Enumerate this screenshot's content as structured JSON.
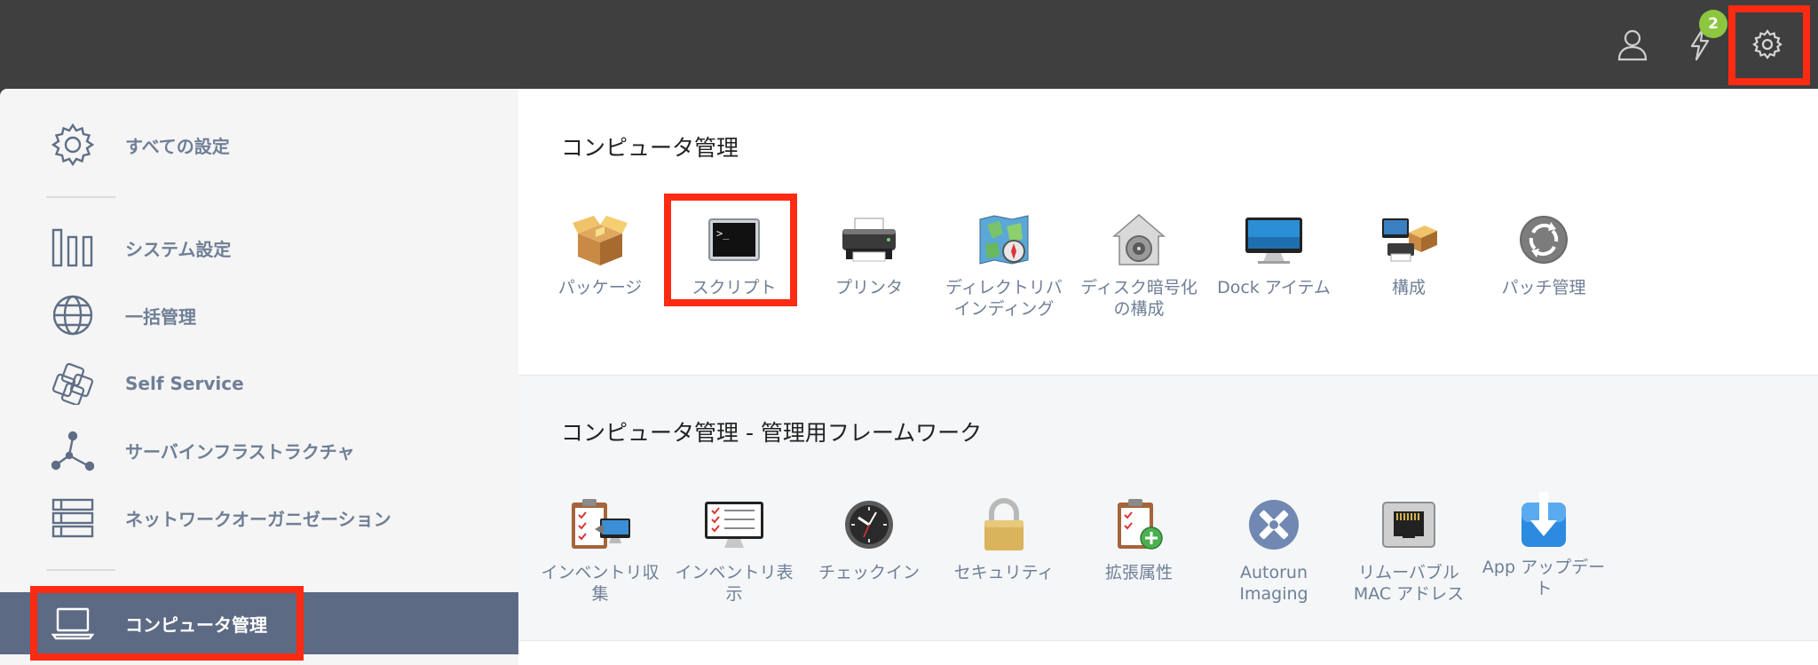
{
  "header": {
    "notification_count": "2"
  },
  "sidebar": {
    "items": [
      {
        "label": "すべての設定",
        "icon": "gear-icon"
      },
      {
        "label": "システム設定",
        "icon": "bar-columns-icon"
      },
      {
        "label": "一括管理",
        "icon": "globe-icon"
      },
      {
        "label": "Self Service",
        "icon": "self-service-icon"
      },
      {
        "label": "サーバインフラストラクチャ",
        "icon": "network-nodes-icon"
      },
      {
        "label": "ネットワークオーガニゼーション",
        "icon": "server-rack-icon"
      },
      {
        "label": "コンピュータ管理",
        "icon": "laptop-icon"
      }
    ]
  },
  "main": {
    "section1": {
      "title": "コンピュータ管理",
      "tiles": [
        {
          "label": "パッケージ",
          "icon": "package-icon"
        },
        {
          "label": "スクリプト",
          "icon": "terminal-icon"
        },
        {
          "label": "プリンタ",
          "icon": "printer-icon"
        },
        {
          "label": "ディレクトリバインディング",
          "icon": "directory-map-icon"
        },
        {
          "label": "ディスク暗号化の構成",
          "icon": "disk-encryption-icon"
        },
        {
          "label": "Dock アイテム",
          "icon": "dock-monitor-icon"
        },
        {
          "label": "構成",
          "icon": "configuration-icon"
        },
        {
          "label": "パッチ管理",
          "icon": "patch-icon"
        }
      ]
    },
    "section2": {
      "title": "コンピュータ管理 - 管理用フレームワーク",
      "tiles": [
        {
          "label": "インベントリ収集",
          "icon": "inventory-collection-icon"
        },
        {
          "label": "インベントリ表示",
          "icon": "inventory-display-icon"
        },
        {
          "label": "チェックイン",
          "icon": "clock-icon"
        },
        {
          "label": "セキュリティ",
          "icon": "lock-icon"
        },
        {
          "label": "拡張属性",
          "icon": "extension-attributes-icon"
        },
        {
          "label": "Autorun Imaging",
          "icon": "autorun-imaging-icon"
        },
        {
          "label": "リムーバブル MAC アドレス",
          "icon": "ethernet-port-icon"
        },
        {
          "label": "App アップデート",
          "icon": "app-update-icon"
        }
      ]
    }
  }
}
